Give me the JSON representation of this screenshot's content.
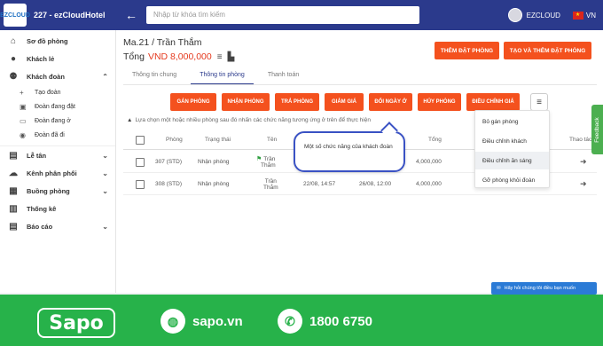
{
  "header": {
    "logo_text": "EZCLOUD",
    "hotel_name": "227 - ezCloudHotel",
    "back_icon": "arrow-left-icon",
    "search_placeholder": "Nhập từ khóa tìm kiếm",
    "username": "EZCLOUD",
    "language": "VN"
  },
  "sidebar": {
    "items": [
      {
        "label": "Sơ đồ phòng",
        "icon": "home-icon"
      },
      {
        "label": "Khách lẻ",
        "icon": "user-icon"
      },
      {
        "label": "Khách đoàn",
        "icon": "users-icon"
      },
      {
        "label": "Lễ tân",
        "icon": "briefcase-icon"
      },
      {
        "label": "Kênh phân phối",
        "icon": "cloud-icon"
      },
      {
        "label": "Buồng phòng",
        "icon": "building-icon"
      },
      {
        "label": "Thống kê",
        "icon": "chart-icon"
      },
      {
        "label": "Báo cáo",
        "icon": "calendar-icon"
      }
    ],
    "subitems": [
      {
        "label": "Tạo đoàn"
      },
      {
        "label": "Đoàn đang đặt"
      },
      {
        "label": "Đoàn đang ở"
      },
      {
        "label": "Đoàn đã đi"
      }
    ]
  },
  "main": {
    "title": "Ma.21 / Trần Thắm",
    "total_label": "Tổng",
    "total_amount": "VND 8,000,000",
    "btn_add_room": "THÊM ĐẶT PHÒNG",
    "btn_create_add_room": "TẠO VÀ THÊM ĐẶT PHÒNG",
    "tabs": [
      "Thông tin chung",
      "Thông tin phòng",
      "Thanh toán"
    ],
    "actions": [
      "GÁN PHÒNG",
      "NHẬN PHÒNG",
      "TRẢ PHÒNG",
      "GIẢM GIÁ",
      "ĐỔI NGÀY Ở",
      "HỦY PHÒNG",
      "ĐIỀU CHỈNH GIÁ"
    ],
    "hint": "Lựa chọn một hoặc nhiều phòng sau đó nhấn các chức năng tương ứng ở trên để thực hiện",
    "columns": {
      "room": "Phòng",
      "status": "Trạng thái",
      "name": "Tên",
      "total": "Tổng",
      "actions": "Thao tác"
    },
    "rows": [
      {
        "room": "307 (STD)",
        "status": "Nhận phòng",
        "name1": "Trần",
        "name2": "Thắm",
        "checkin": "",
        "checkout": "",
        "total": "4,000,000"
      },
      {
        "room": "308 (STD)",
        "status": "Nhận phòng",
        "name1": "Trần",
        "name2": "Thắm",
        "checkin": "22/08, 14:57",
        "checkout": "26/08, 12:00",
        "total": "4,000,000"
      }
    ],
    "callout": "Một số chức năng của khách đoàn",
    "dropdown": [
      "Bỏ gán phòng",
      "Điều chỉnh khách",
      "Điều chỉnh ăn sáng",
      "Gỡ phòng khỏi đoàn"
    ]
  },
  "feedback": "Feedback",
  "chat": "Hãy hỏi chúng tôi điều bạn muốn",
  "footer": {
    "brand": "Sapo",
    "website": "sapo.vn",
    "phone": "1800 6750"
  },
  "colors": {
    "header": "#2b3a8c",
    "accent": "#f4511e",
    "footer": "#27b24a"
  }
}
